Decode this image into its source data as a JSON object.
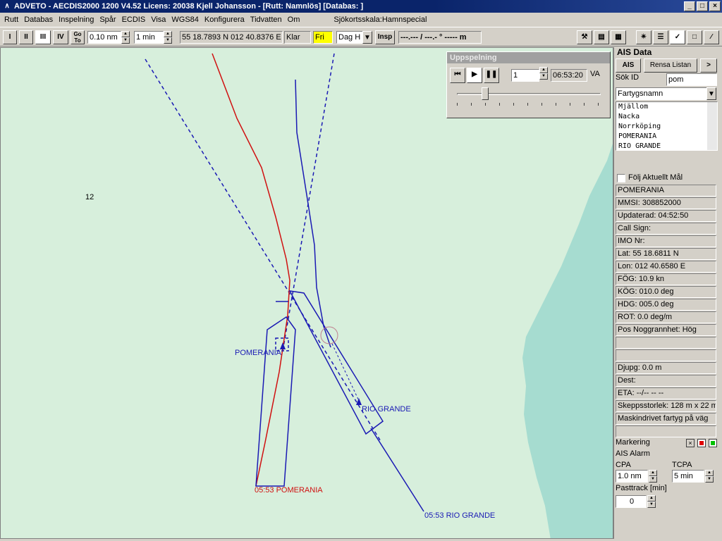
{
  "window": {
    "title": "ADVETO - AECDIS2000 1200 V4.52  Licens: 20038 Kjell Johansson - [Rutt: Namnlös] [Databas: ]"
  },
  "menu": [
    "Rutt",
    "Databas",
    "Inspelning",
    "Spår",
    "ECDIS",
    "Visa",
    "WGS84",
    "Konfigurera",
    "Tidvatten",
    "Om"
  ],
  "scale_label": "Sjökortsskala:Hamnspecial",
  "toolbar": {
    "btn1": "I",
    "btn2": "II",
    "btn3": "III",
    "btn4": "IV",
    "goto": "Go To",
    "range": "0.10 nm",
    "interval": "1 min",
    "position": "55 18.7893 N  012 40.8376 E",
    "status": "Klar",
    "mode": "Fri",
    "daymode": "Dag H",
    "insp": "Insp",
    "readout": "---.--- / ---.- ° ----- m"
  },
  "map": {
    "depth_label": "12",
    "pomerania_label": "POMERANIA",
    "rio_label": "RIO GRANDE",
    "pomerania_track_label": "05:53 POMERANIA",
    "rio_track_label": "05:53 RIO GRANDE",
    "colors": {
      "water": "#d7efdc",
      "land": "#a6dcd0",
      "route": "#1a1ab4",
      "own": "#d01010"
    }
  },
  "playback": {
    "title": "Uppspelning",
    "speed": "1",
    "time": "06:53:20",
    "suffix": "VA",
    "slider_position": 0.18
  },
  "ais": {
    "header": "AIS Data",
    "ais_button": "AIS",
    "clear_button": "Rensa Listan",
    "next_button": ">",
    "search_label": "Sök ID",
    "search_value": "pom",
    "sort_select": "Fartygsnamn",
    "vessels": [
      "Mjällom",
      "Nacka",
      "Norrköping",
      "POMERANIA",
      "RIO GRANDE"
    ],
    "follow_label": "Följ Aktuellt Mål",
    "details": [
      "POMERANIA",
      "MMSI: 308852000",
      "Updaterad: 04:52:50",
      "Call Sign:",
      "IMO Nr:",
      "Lat: 55 18.6811 N",
      "Lon: 012 40.6580 E",
      "FÖG: 10.9 kn",
      "KÖG: 010.0 deg",
      "HDG: 005.0 deg",
      "ROT: 0.0 deg/m",
      "Pos Noggrannhet:  Hög",
      "",
      "",
      "Djupg: 0.0 m",
      "Dest:",
      "ETA: --/-- -- --",
      "Skeppsstorlek: 128 m x 22 m",
      "Maskindrivet fartyg på väg",
      ""
    ],
    "marking_label": "Markering",
    "alarm_label": "AIS Alarm",
    "cpa_label": "CPA",
    "cpa_value": "1.0 nm",
    "tcpa_label": "TCPA",
    "tcpa_value": "5 min",
    "pasttrack_label": "Pasttrack [min]",
    "pasttrack_value": "0"
  }
}
